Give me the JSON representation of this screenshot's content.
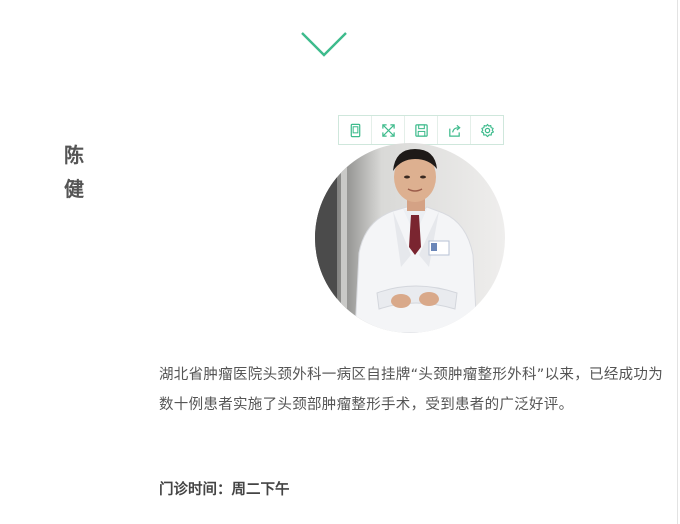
{
  "accent_color": "#3dbb8c",
  "doctor": {
    "name": "陈健",
    "photo_icon": "doctor-portrait-photo"
  },
  "toolbar": {
    "items": [
      {
        "icon": "copy-icon"
      },
      {
        "icon": "expand-icon"
      },
      {
        "icon": "save-icon"
      },
      {
        "icon": "share-icon"
      },
      {
        "icon": "settings-icon"
      }
    ]
  },
  "bio": {
    "text": "湖北省肿瘤医院头颈外科一病区自挂牌“头颈肿瘤整形外科”以来，已经成功为数十例患者实施了头颈部肿瘤整形手术，受到患者的广泛好评。"
  },
  "clinic": {
    "hours": "门诊时间：周二下午"
  }
}
